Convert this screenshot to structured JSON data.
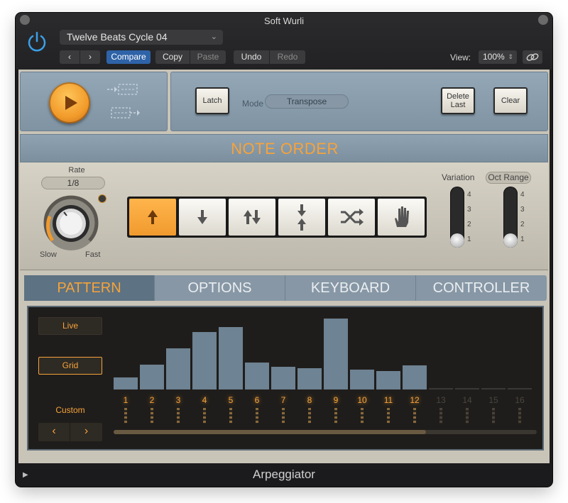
{
  "window": {
    "title": "Soft Wurli"
  },
  "header": {
    "preset_name": "Twelve Beats Cycle 04",
    "compare_label": "Compare",
    "copy_label": "Copy",
    "paste_label": "Paste",
    "undo_label": "Undo",
    "redo_label": "Redo",
    "view_label": "View:",
    "zoom_value": "100%"
  },
  "transport": {
    "latch_label": "Latch",
    "mode_label": "Mode",
    "mode_value": "Transpose",
    "delete_last_label_1": "Delete",
    "delete_last_label_2": "Last",
    "clear_label": "Clear"
  },
  "note_order": {
    "title": "NOTE ORDER",
    "rate_label": "Rate",
    "rate_value": "1/8",
    "slow_label": "Slow",
    "fast_label": "Fast",
    "variation_label": "Variation",
    "oct_range_label": "Oct Range",
    "variation_value": 1,
    "oct_range_value": 1,
    "slider_numbers": [
      "4",
      "3",
      "2",
      "1"
    ],
    "orders": [
      {
        "name": "up",
        "icon": "arrow-up-icon",
        "active": true
      },
      {
        "name": "down",
        "icon": "arrow-down-icon",
        "active": false
      },
      {
        "name": "up-down",
        "icon": "arrows-up-down-icon",
        "active": false
      },
      {
        "name": "outside-in",
        "icon": "arrows-converge-icon",
        "active": false
      },
      {
        "name": "random",
        "icon": "shuffle-icon",
        "active": false
      },
      {
        "name": "as-played",
        "icon": "hand-icon",
        "active": false
      }
    ],
    "accent_color": "#f6a33b"
  },
  "tabs": [
    {
      "label": "PATTERN",
      "active": true
    },
    {
      "label": "OPTIONS",
      "active": false
    },
    {
      "label": "KEYBOARD",
      "active": false
    },
    {
      "label": "CONTROLLER",
      "active": false
    }
  ],
  "pattern": {
    "live_label": "Live",
    "grid_label": "Grid",
    "custom_label": "Custom",
    "steps": [
      "1",
      "2",
      "3",
      "4",
      "5",
      "6",
      "7",
      "8",
      "9",
      "10",
      "11",
      "12",
      "13",
      "14",
      "15",
      "16"
    ],
    "step_levels": [
      0.15,
      0.3,
      0.5,
      0.7,
      0.76,
      0.33,
      0.28,
      0.26,
      0.86,
      0.24,
      0.22,
      0.29,
      0,
      0,
      0,
      0
    ],
    "active_steps": 12
  },
  "footer": {
    "title": "Arpeggiator"
  }
}
